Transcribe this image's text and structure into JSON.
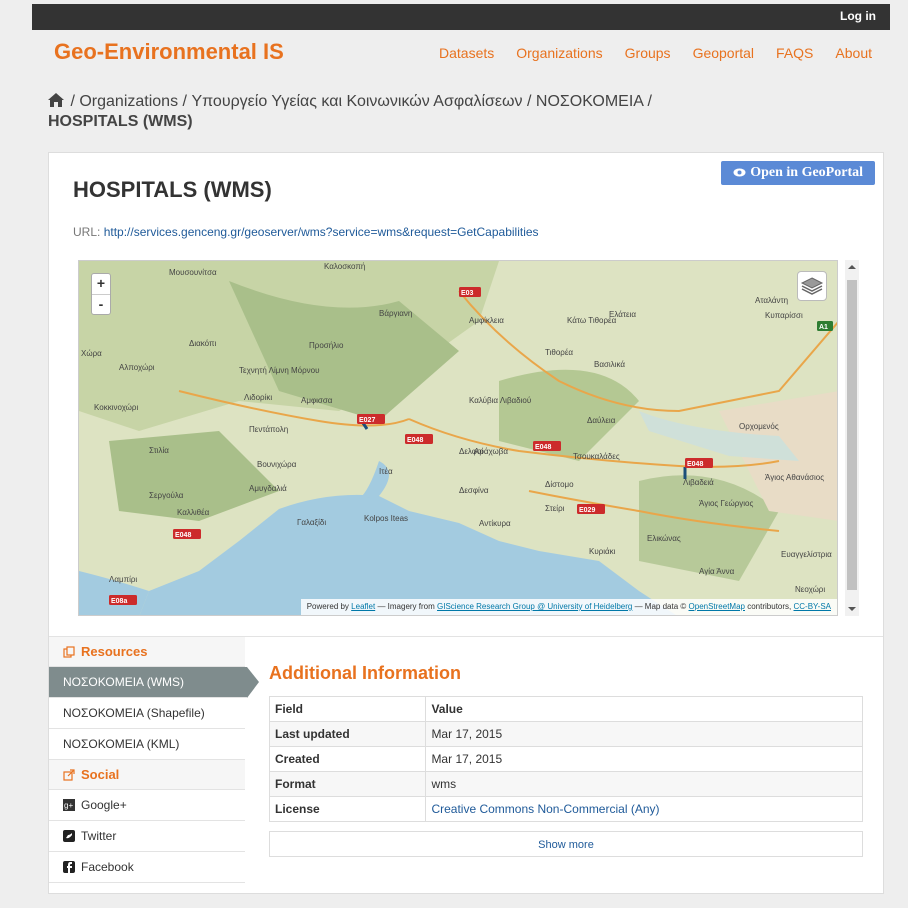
{
  "topbar": {
    "login_label": "Log in"
  },
  "header": {
    "brand": "Geo-Environmental IS",
    "nav": [
      "Datasets",
      "Organizations",
      "Groups",
      "Geoportal",
      "FAQS",
      "About"
    ]
  },
  "breadcrumb": {
    "sep": "/",
    "items": [
      "Organizations",
      "Υπουργείο Υγείας και Κοινωνικών Ασφαλίσεων",
      "ΝΟΣΟΚΟΜΕΙΑ"
    ],
    "current": "HOSPITALS (WMS)"
  },
  "resource": {
    "open_button": "Open in GeoPortal",
    "title": "HOSPITALS (WMS)",
    "url_label": "URL:",
    "url": "http://services.genceng.gr/geoserver/wms?service=wms&request=GetCapabilities"
  },
  "map": {
    "zoom_in": "+",
    "zoom_out": "-",
    "attribution": {
      "powered": "Powered by",
      "leaflet": "Leaflet",
      "imagery": "— Imagery from",
      "giscience": "GIScience Research Group @ University of Heidelberg",
      "mapdata": "— Map data ©",
      "osm": "OpenStreetMap",
      "contributors": "contributors,",
      "license": "CC-BY-SA"
    },
    "places": [
      "Μουσουνίτσα",
      "Καλοσκοπή",
      "Βάργιανη",
      "Αμφίκλεια",
      "Κάτω Τιθορέα",
      "Ελάτεια",
      "Αταλάντη",
      "Κυπαρίσσι",
      "Διακόπι",
      "Προσήλιο",
      "Τιθορέα",
      "Βασιλικά",
      "Χώρα",
      "Αλποχώρι",
      "Τεχνητή Λίμνη Μόρνου",
      "Λιδορίκι",
      "Αμφισσα",
      "Καλύβια Λιβαδιού",
      "Δαύλεια",
      "Ορχομενός",
      "Κοκκινοχώρι",
      "Πεντάπολη",
      "Δελφοί",
      "Αράχωβα",
      "Τσουκαλάδες",
      "Στιλία",
      "Βουνιχώρα",
      "Ιτέα",
      "Λιβαδειά",
      "Άγιος Αθανάσιος",
      "Σεργούλα",
      "Αμυγδαλιά",
      "Δεσφίνα",
      "Δίστομο",
      "Άγιος Γεώργιος",
      "Καλλιθέα",
      "Γαλαξίδι",
      "Kolpos Iteas",
      "Αντίκυρα",
      "Στείρι",
      "Ελικώνας",
      "Κυριάκι",
      "Ευαγγελίστρια",
      "Αγία Άννα",
      "Λαμπίρι",
      "Νεοχώρι"
    ],
    "road_labels": [
      "E03",
      "E027",
      "E048",
      "E048",
      "E048",
      "E029",
      "E048",
      "E08a",
      "A1"
    ]
  },
  "sidebar": {
    "resources_heading": "Resources",
    "resources": [
      "ΝΟΣΟΚΟΜΕΙΑ (WMS)",
      "ΝΟΣΟΚΟΜΕΙΑ (Shapefile)",
      "ΝΟΣΟΚΟΜΕΙΑ (KML)"
    ],
    "social_heading": "Social",
    "social": [
      "Google+",
      "Twitter",
      "Facebook"
    ]
  },
  "info": {
    "heading": "Additional Information",
    "columns": [
      "Field",
      "Value"
    ],
    "rows": [
      [
        "Last updated",
        "Mar 17, 2015"
      ],
      [
        "Created",
        "Mar 17, 2015"
      ],
      [
        "Format",
        "wms"
      ],
      [
        "License",
        "Creative Commons Non-Commercial (Any)"
      ]
    ],
    "show_more": "Show more"
  },
  "colors": {
    "brand": "#e8721f",
    "button": "#5b8ad6",
    "active_item": "#7f8c8d",
    "link": "#1f5a99"
  }
}
